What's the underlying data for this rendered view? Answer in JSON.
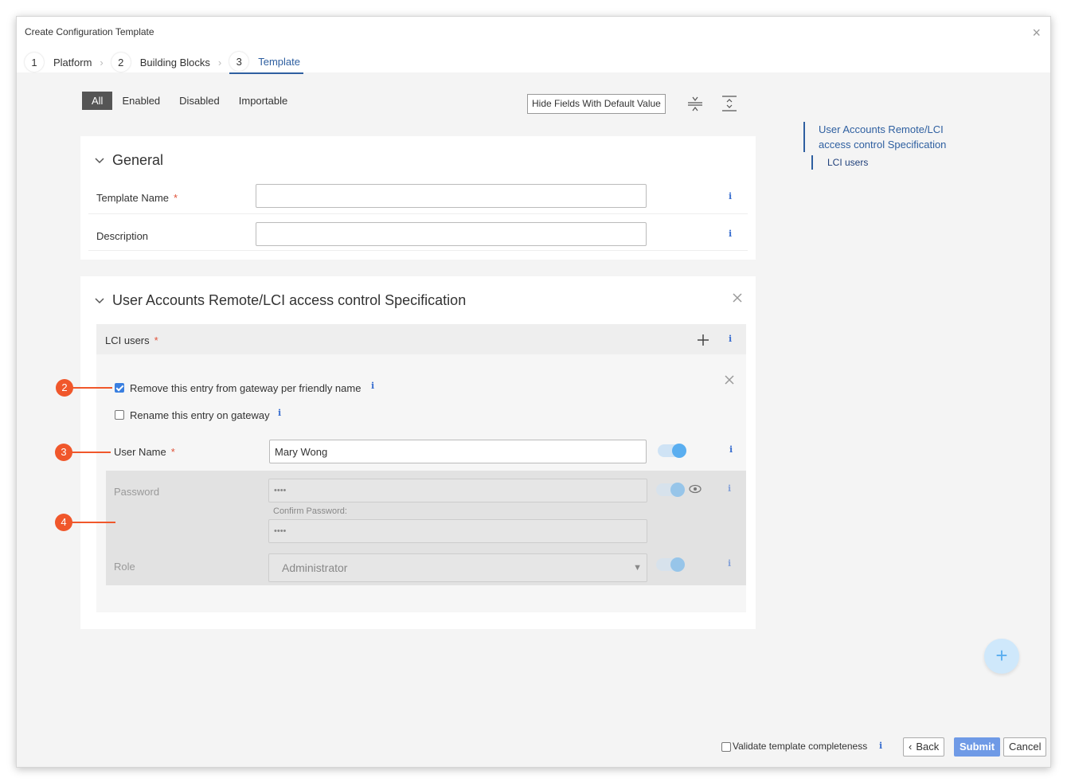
{
  "dialog": {
    "title": "Create Configuration Template",
    "close": "×"
  },
  "steps": [
    {
      "num": "1",
      "label": "Platform"
    },
    {
      "num": "2",
      "label": "Building Blocks"
    },
    {
      "num": "3",
      "label": "Template"
    }
  ],
  "filters": [
    "All",
    "Enabled",
    "Disabled",
    "Importable"
  ],
  "toolbar": {
    "hide_fields": "Hide Fields With Default Value",
    "collapse_icon": "collapse-all-icon",
    "expand_icon": "expand-all-icon"
  },
  "toc": {
    "section": "User Accounts Remote/LCI access control Specification",
    "sub": "LCI users"
  },
  "general": {
    "title": "General",
    "template_name_label": "Template Name",
    "template_name_value": "",
    "description_label": "Description",
    "description_value": ""
  },
  "spec": {
    "title": "User Accounts Remote/LCI access control Specification",
    "lci_users_label": "LCI users",
    "remove_entry_label": "Remove this entry from gateway per friendly name",
    "remove_entry_checked": true,
    "rename_entry_label": "Rename this entry on gateway",
    "rename_entry_checked": false,
    "user_name_label": "User Name",
    "user_name_value": "Mary Wong",
    "password_label": "Password",
    "password_value": "••••",
    "confirm_password_label": "Confirm Password:",
    "confirm_password_value": "••••",
    "role_label": "Role",
    "role_value": "Administrator"
  },
  "callouts": [
    "2",
    "3",
    "4"
  ],
  "footer": {
    "validate_label": "Validate template completeness",
    "back": "Back",
    "submit": "Submit",
    "cancel": "Cancel"
  },
  "required_mark": "*",
  "info_mark": "i",
  "colors": {
    "accent": "#2e5fa0",
    "callout": "#f0572b",
    "toggle": "#5aaef0",
    "submit": "#6f9ae6"
  }
}
